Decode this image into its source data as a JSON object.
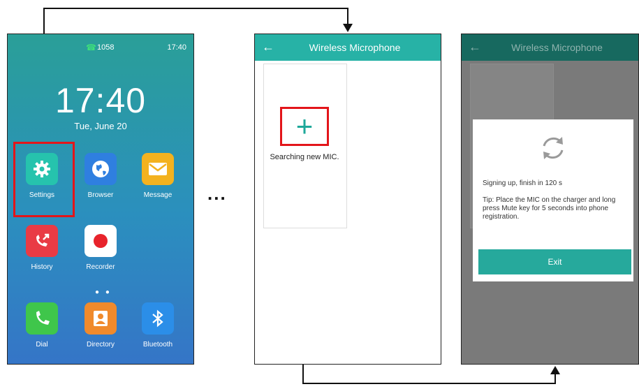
{
  "home": {
    "ext": "1058",
    "status_time": "17:40",
    "clock": "17:40",
    "date": "Tue, June 20",
    "apps": [
      {
        "label": "Settings",
        "color": "#26c3ad",
        "icon": "gear-icon"
      },
      {
        "label": "Browser",
        "color": "#2f7fe0",
        "icon": "globe-icon"
      },
      {
        "label": "Message",
        "color": "#f3b21f",
        "icon": "envelope-icon"
      },
      {
        "label": "History",
        "color": "#e93b45",
        "icon": "missed-call-icon"
      },
      {
        "label": "Recorder",
        "color": "#ffffff",
        "icon": "record-icon"
      },
      {
        "label": "Dial",
        "color": "#3fc64b",
        "icon": "phone-icon"
      },
      {
        "label": "Directory",
        "color": "#f08a2c",
        "icon": "contact-icon"
      },
      {
        "label": "Bluetooth",
        "color": "#2b8ee8",
        "icon": "bluetooth-icon"
      }
    ],
    "page_dots": "● ●"
  },
  "ellipsis": "...",
  "wireless": {
    "title": "Wireless Microphone",
    "back": "←",
    "add_symbol": "+",
    "card_text": "Searching new MIC."
  },
  "dialog": {
    "title": "Wireless Microphone",
    "back": "←",
    "signing": "Signing up, finish in 120 s",
    "tip": "Tip: Place the MIC on the charger and long press Mute key for 5 seconds into phone registration.",
    "exit": "Exit"
  },
  "colors": {
    "teal": "#27b2a6",
    "highlight": "#e3151a"
  }
}
